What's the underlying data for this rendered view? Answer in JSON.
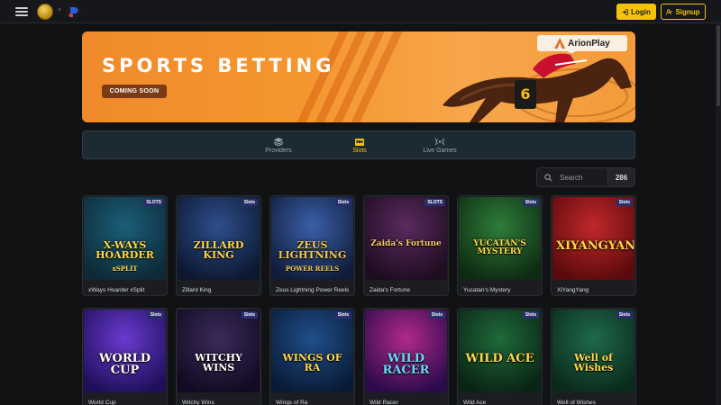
{
  "header": {
    "login_label": "Login",
    "signup_label": "Signup"
  },
  "banner": {
    "title": "SPORTS BETTING",
    "cta_label": "COMING SOON",
    "brand": "ArionPlay",
    "jockey_number": "6"
  },
  "tabs": [
    {
      "label": "Providers",
      "icon": "layers-icon",
      "active": false
    },
    {
      "label": "Slots",
      "icon": "slot-machine-icon",
      "active": true
    },
    {
      "label": "Live Games",
      "icon": "broadcast-icon",
      "active": false
    }
  ],
  "search": {
    "placeholder": "Search",
    "count": "286"
  },
  "games": [
    {
      "name": "xWays Hoarder xSplit",
      "badge": "SLOTS",
      "art_title": "X-WAYS HOARDER",
      "art_sub": "xSPLIT",
      "colors": [
        "#1b5e7a",
        "#0d2a36"
      ],
      "title_color": "#ffd84a"
    },
    {
      "name": "Zillard King",
      "badge": "Slots",
      "art_title": "ZILLARD KING",
      "art_sub": "",
      "colors": [
        "#2e4e8c",
        "#0c1830"
      ],
      "title_color": "#ffd84a"
    },
    {
      "name": "Zeus Lightning Power Reels",
      "badge": "Slots",
      "art_title": "ZEUS LIGHTNING",
      "art_sub": "POWER REELS",
      "colors": [
        "#3a5fa8",
        "#101c3a"
      ],
      "title_color": "#f2c94c"
    },
    {
      "name": "Zaida's Fortune",
      "badge": "SLOTS",
      "art_title": "Zaida's Fortune",
      "art_sub": "",
      "colors": [
        "#5a2a5e",
        "#1e0c20"
      ],
      "title_color": "#f4c86a"
    },
    {
      "name": "Yucatan's Mystery",
      "badge": "Slots",
      "art_title": "YUCATAN'S MYSTERY",
      "art_sub": "",
      "colors": [
        "#2e7d3a",
        "#0e2a12"
      ],
      "title_color": "#ffd84a"
    },
    {
      "name": "XiYangYang",
      "badge": "Slots",
      "art_title": "XIYANGYANG",
      "art_sub": "",
      "colors": [
        "#c0282a",
        "#5a0a0c"
      ],
      "title_color": "#ffd84a"
    },
    {
      "name": "World Cup",
      "badge": "Slots",
      "art_title": "WORLD CUP",
      "art_sub": "",
      "colors": [
        "#6a3ad0",
        "#1f0f5a"
      ],
      "title_color": "#ffffff"
    },
    {
      "name": "Witchy Wins",
      "badge": "Slots",
      "art_title": "WITCHY WINS",
      "art_sub": "",
      "colors": [
        "#3a2a5a",
        "#120a22"
      ],
      "title_color": "#ffffff"
    },
    {
      "name": "Wings of Ra",
      "badge": "Slots",
      "art_title": "WINGS OF RA",
      "art_sub": "",
      "colors": [
        "#1f4f8a",
        "#0a1a36"
      ],
      "title_color": "#ffd84a"
    },
    {
      "name": "Wild Racer",
      "badge": "Slots",
      "art_title": "WILD RACER",
      "art_sub": "",
      "colors": [
        "#b02a8a",
        "#2a0a4a"
      ],
      "title_color": "#6ad8ff"
    },
    {
      "name": "Wild Ace",
      "badge": "Slots",
      "art_title": "WILD ACE",
      "art_sub": "",
      "colors": [
        "#1f6a3a",
        "#0a2414"
      ],
      "title_color": "#ffd84a"
    },
    {
      "name": "Well of Wishes",
      "badge": "Slots",
      "art_title": "Well of Wishes",
      "art_sub": "",
      "colors": [
        "#1f6a4a",
        "#0a2a1c"
      ],
      "title_color": "#ffd84a"
    }
  ]
}
